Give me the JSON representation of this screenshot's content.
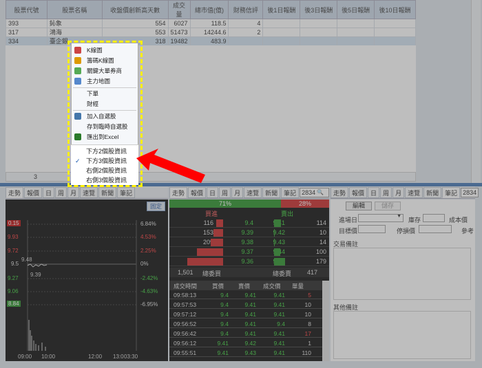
{
  "grid": {
    "headers": [
      "股票代號",
      "股票名稱",
      "收盤價創新高天數",
      "成交量",
      "總市值(億)",
      "財務信評",
      "後1日報酬",
      "後3日報酬",
      "後5日報酬",
      "後10日報酬"
    ],
    "rows": [
      {
        "code": "393",
        "name": "鈊象",
        "days": "554",
        "vol": "6027",
        "cap": "118.5",
        "rating": "4"
      },
      {
        "code": "317",
        "name": "鴻海",
        "days": "553",
        "vol": "51473",
        "cap": "14244.6",
        "rating": "2"
      },
      {
        "code": "334",
        "name": "臺企銀",
        "days": "318",
        "vol": "19482",
        "cap": "483.9",
        "rating": ""
      }
    ],
    "footer_value": "3"
  },
  "menu": {
    "items": [
      "K線圖",
      "籌碼K線圖",
      "關鍵大單券商",
      "主力地圖",
      "下單",
      "財經",
      "加入自選股",
      "存到臨時自選股",
      "匯出到Excel"
    ],
    "sub_items": [
      "下方2個股資訊",
      "下方3個股資訊",
      "右側2個股資訊",
      "右側3個股資訊"
    ],
    "checked": "✓"
  },
  "left": {
    "tabs": [
      "走勢",
      "報價",
      "日",
      "周",
      "月",
      "速覽",
      "新聞",
      "筆記"
    ],
    "code": "2834",
    "fixed_btn": "固定",
    "prices": [
      "0.15",
      "9.93",
      "9.72",
      "9.5",
      "9.27",
      "9.06",
      "8.84"
    ],
    "pcts": [
      "6.84%",
      "4.53%",
      "2.25%",
      "0%",
      "-2.42%",
      "-4.63%",
      "-6.95%"
    ],
    "times": [
      "09:00",
      "10:00",
      "12:00",
      "13:0",
      "03:30"
    ],
    "label1": "9.48",
    "label2": "9.39",
    "colors": {
      "up": "#ff3333",
      "down": "#33cc33",
      "line": "#cccccc"
    }
  },
  "mid": {
    "tabs": [
      "走勢",
      "報價",
      "日",
      "周",
      "月",
      "速覽",
      "新聞",
      "筆記"
    ],
    "code": "2834",
    "buy_pct": "71%",
    "sell_pct": "28%",
    "buy_label": "買進",
    "sell_label": "賣出",
    "book": [
      {
        "bq": "116",
        "bp": "9.4",
        "sp": "9.41",
        "sq": "114",
        "bw": 0.2,
        "sw": 0.2
      },
      {
        "bq": "153",
        "bp": "9.39",
        "sp": "9.42",
        "sq": "10",
        "bw": 0.26,
        "sw": 0.02
      },
      {
        "bq": "209",
        "bp": "9.38",
        "sp": "9.43",
        "sq": "14",
        "bw": 0.35,
        "sw": 0.02
      },
      {
        "bq": "430",
        "bp": "9.37",
        "sp": "9.44",
        "sq": "100",
        "bw": 0.73,
        "sw": 0.18
      },
      {
        "bq": "593",
        "bp": "9.36",
        "sp": "9.45",
        "sq": "179",
        "bw": 1.0,
        "sw": 0.3
      }
    ],
    "total_buy": "1,501",
    "total_buy_label": "總委買",
    "total_sell_label": "總委賣",
    "total_sell": "417",
    "trade_headers": [
      "成交時間",
      "買價",
      "賣價",
      "成交價",
      "單量"
    ],
    "trades": [
      [
        "09:58:13",
        "9.4",
        "9.41",
        "9.41",
        "5"
      ],
      [
        "09:57:53",
        "9.4",
        "9.41",
        "9.41",
        "10"
      ],
      [
        "09:57:12",
        "9.4",
        "9.41",
        "9.41",
        "10"
      ],
      [
        "09:56:52",
        "9.4",
        "9.41",
        "9.4",
        "8"
      ],
      [
        "09:56:42",
        "9.4",
        "9.41",
        "9.41",
        "17"
      ],
      [
        "09:56:12",
        "9.41",
        "9.42",
        "9.41",
        "1"
      ],
      [
        "09:55:51",
        "9.41",
        "9.43",
        "9.41",
        "110"
      ]
    ]
  },
  "right": {
    "tabs": [
      "走勢",
      "報價",
      "日",
      "周",
      "月",
      "速覽",
      "新聞",
      "筆記"
    ],
    "code": "2834",
    "edit_btn": "編輯",
    "save_btn": "儲存",
    "entry_date": "進場日",
    "stock_label": "庫存",
    "cost_label": "成本價",
    "target_label": "目標價",
    "stop_label": "停損價",
    "ref_label": "參考",
    "trade_note": "交易備註",
    "other_note": "其他備註"
  }
}
